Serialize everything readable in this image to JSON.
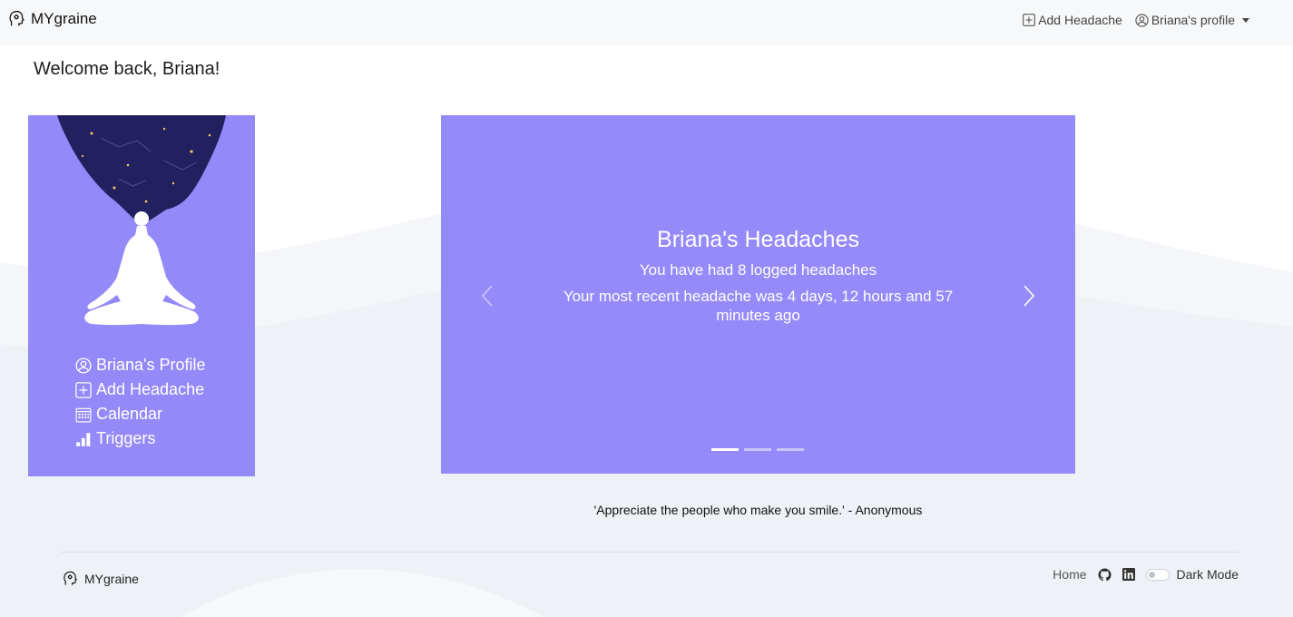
{
  "navbar": {
    "brand": "MYgraine",
    "add_headache": "Add Headache",
    "profile": "Briana's profile"
  },
  "welcome": "Welcome back, Briana!",
  "sidebar": {
    "items": [
      {
        "label": "Briana's Profile",
        "icon": "user-circle-icon"
      },
      {
        "label": "Add Headache",
        "icon": "plus-square-icon"
      },
      {
        "label": "Calendar",
        "icon": "calendar-icon"
      },
      {
        "label": "Triggers",
        "icon": "bar-chart-icon"
      }
    ]
  },
  "carousel": {
    "title": "Briana's Headaches",
    "line1": "You have had 8 logged headaches",
    "line2": "Your most recent headache was 4 days, 12 hours and 57 minutes ago",
    "slide_count": 3,
    "active_slide": 1
  },
  "quote": "'Appreciate the people who make you smile.' - Anonymous",
  "footer": {
    "brand": "MYgraine",
    "home": "Home",
    "dark_mode": "Dark Mode",
    "dark_mode_on": false
  },
  "colors": {
    "card": "#958af9",
    "night_sky": "#22205e"
  }
}
